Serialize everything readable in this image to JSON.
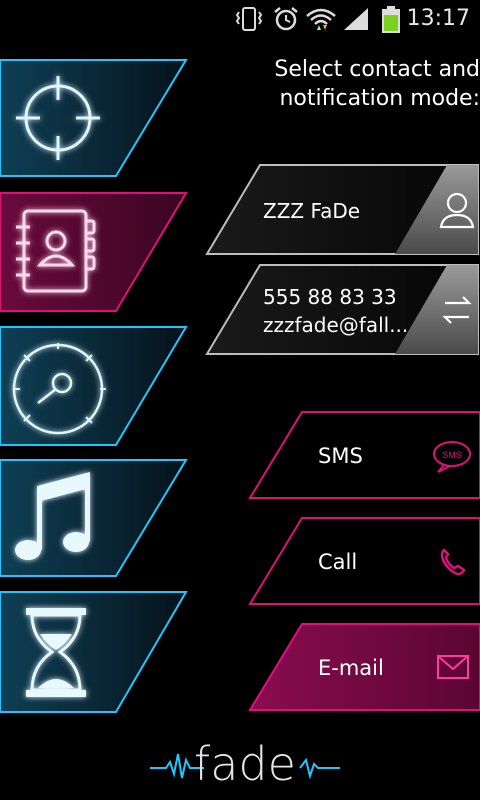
{
  "status_bar": {
    "time": "13:17",
    "icons": [
      "vibrate-icon",
      "alarm-icon",
      "wifi-icon",
      "signal-icon",
      "battery-icon"
    ]
  },
  "sidebar": {
    "items": [
      {
        "id": "target",
        "icon": "crosshair-icon",
        "selected": false
      },
      {
        "id": "contacts",
        "icon": "address-book-icon",
        "selected": true
      },
      {
        "id": "speed",
        "icon": "speedometer-icon",
        "selected": false
      },
      {
        "id": "music",
        "icon": "music-note-icon",
        "selected": false
      },
      {
        "id": "timer",
        "icon": "hourglass-icon",
        "selected": false
      }
    ]
  },
  "header": {
    "line1": "Select contact and",
    "line2": "notification mode:"
  },
  "contact": {
    "name": "ZZZ FaDe",
    "phone": "555 88 83 33",
    "email": "zzzfade@fall..."
  },
  "modes": {
    "sms": {
      "label": "SMS",
      "icon_text": "SMS",
      "selected": false
    },
    "call": {
      "label": "Call",
      "selected": false
    },
    "email": {
      "label": "E-mail",
      "selected": true
    }
  },
  "logo": {
    "text": "fade"
  },
  "colors": {
    "cyan": "#1ec8ff",
    "magenta": "#e0107a",
    "magenta_fill": "#7a0a45",
    "gray": "#8a8a8a"
  }
}
